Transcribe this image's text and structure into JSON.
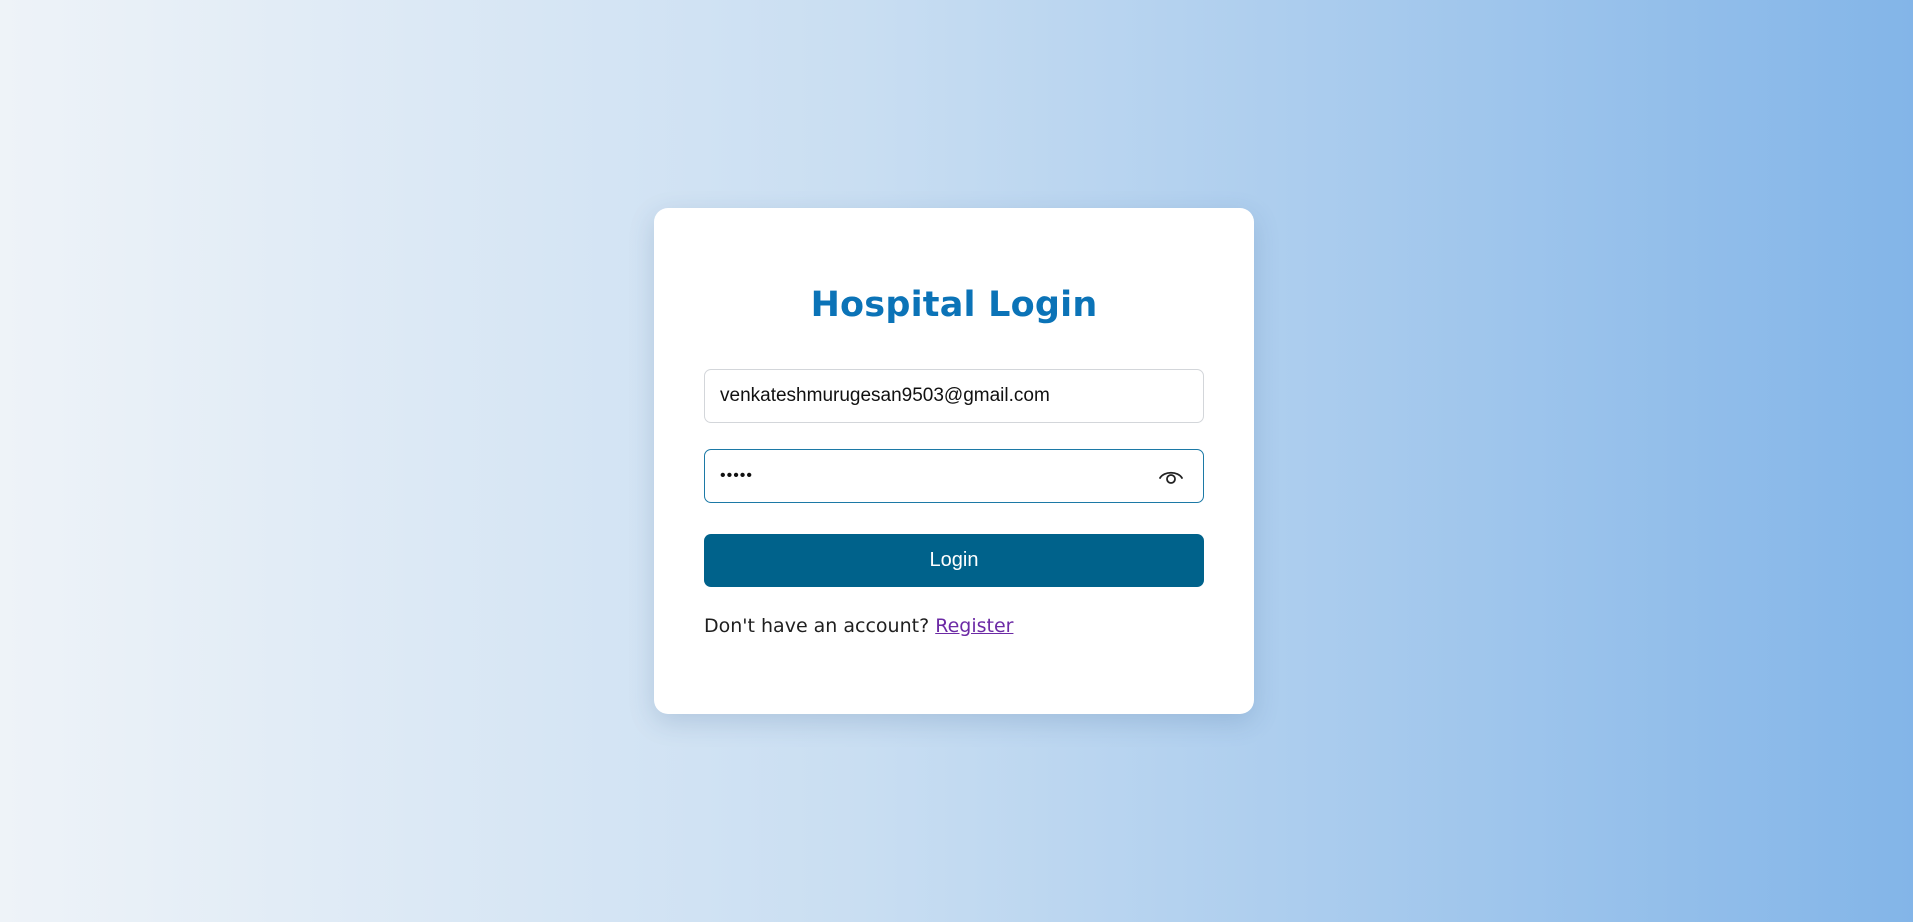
{
  "login": {
    "title": "Hospital Login",
    "email_value": "venkateshmurugesan9503@gmail.com",
    "password_value": "12345",
    "login_label": "Login",
    "prompt_text": "Don't have an account? ",
    "register_label": "Register"
  },
  "icons": {
    "password_toggle": "eye-icon"
  },
  "colors": {
    "title": "#0b73b7",
    "button": "#00628b",
    "link": "#6c2aa5"
  }
}
